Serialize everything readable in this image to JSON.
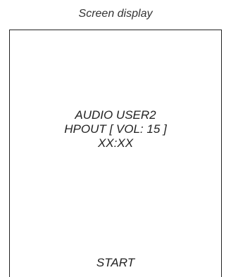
{
  "caption": "Screen display",
  "screen": {
    "lines": [
      "AUDIO USER2",
      "HPOUT [ VOL: 15 ]",
      "XX:XX"
    ],
    "bottom_label": "START"
  }
}
